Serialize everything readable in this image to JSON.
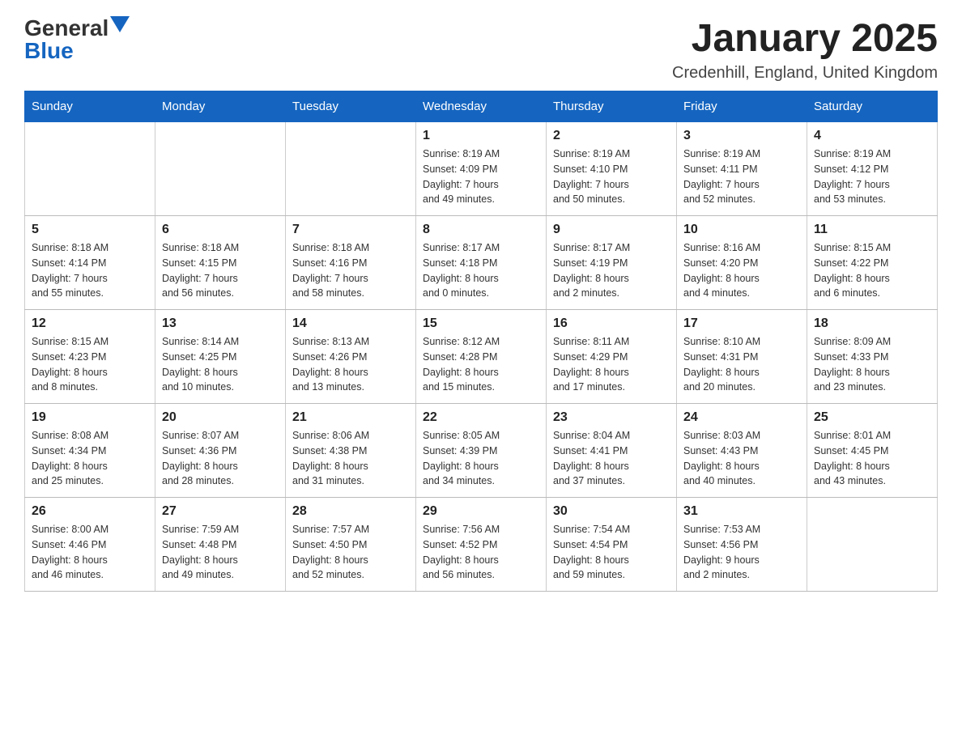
{
  "header": {
    "logo_general": "General",
    "logo_blue": "Blue",
    "month_title": "January 2025",
    "location": "Credenhill, England, United Kingdom"
  },
  "weekdays": [
    "Sunday",
    "Monday",
    "Tuesday",
    "Wednesday",
    "Thursday",
    "Friday",
    "Saturday"
  ],
  "weeks": [
    [
      {
        "day": "",
        "info": ""
      },
      {
        "day": "",
        "info": ""
      },
      {
        "day": "",
        "info": ""
      },
      {
        "day": "1",
        "info": "Sunrise: 8:19 AM\nSunset: 4:09 PM\nDaylight: 7 hours\nand 49 minutes."
      },
      {
        "day": "2",
        "info": "Sunrise: 8:19 AM\nSunset: 4:10 PM\nDaylight: 7 hours\nand 50 minutes."
      },
      {
        "day": "3",
        "info": "Sunrise: 8:19 AM\nSunset: 4:11 PM\nDaylight: 7 hours\nand 52 minutes."
      },
      {
        "day": "4",
        "info": "Sunrise: 8:19 AM\nSunset: 4:12 PM\nDaylight: 7 hours\nand 53 minutes."
      }
    ],
    [
      {
        "day": "5",
        "info": "Sunrise: 8:18 AM\nSunset: 4:14 PM\nDaylight: 7 hours\nand 55 minutes."
      },
      {
        "day": "6",
        "info": "Sunrise: 8:18 AM\nSunset: 4:15 PM\nDaylight: 7 hours\nand 56 minutes."
      },
      {
        "day": "7",
        "info": "Sunrise: 8:18 AM\nSunset: 4:16 PM\nDaylight: 7 hours\nand 58 minutes."
      },
      {
        "day": "8",
        "info": "Sunrise: 8:17 AM\nSunset: 4:18 PM\nDaylight: 8 hours\nand 0 minutes."
      },
      {
        "day": "9",
        "info": "Sunrise: 8:17 AM\nSunset: 4:19 PM\nDaylight: 8 hours\nand 2 minutes."
      },
      {
        "day": "10",
        "info": "Sunrise: 8:16 AM\nSunset: 4:20 PM\nDaylight: 8 hours\nand 4 minutes."
      },
      {
        "day": "11",
        "info": "Sunrise: 8:15 AM\nSunset: 4:22 PM\nDaylight: 8 hours\nand 6 minutes."
      }
    ],
    [
      {
        "day": "12",
        "info": "Sunrise: 8:15 AM\nSunset: 4:23 PM\nDaylight: 8 hours\nand 8 minutes."
      },
      {
        "day": "13",
        "info": "Sunrise: 8:14 AM\nSunset: 4:25 PM\nDaylight: 8 hours\nand 10 minutes."
      },
      {
        "day": "14",
        "info": "Sunrise: 8:13 AM\nSunset: 4:26 PM\nDaylight: 8 hours\nand 13 minutes."
      },
      {
        "day": "15",
        "info": "Sunrise: 8:12 AM\nSunset: 4:28 PM\nDaylight: 8 hours\nand 15 minutes."
      },
      {
        "day": "16",
        "info": "Sunrise: 8:11 AM\nSunset: 4:29 PM\nDaylight: 8 hours\nand 17 minutes."
      },
      {
        "day": "17",
        "info": "Sunrise: 8:10 AM\nSunset: 4:31 PM\nDaylight: 8 hours\nand 20 minutes."
      },
      {
        "day": "18",
        "info": "Sunrise: 8:09 AM\nSunset: 4:33 PM\nDaylight: 8 hours\nand 23 minutes."
      }
    ],
    [
      {
        "day": "19",
        "info": "Sunrise: 8:08 AM\nSunset: 4:34 PM\nDaylight: 8 hours\nand 25 minutes."
      },
      {
        "day": "20",
        "info": "Sunrise: 8:07 AM\nSunset: 4:36 PM\nDaylight: 8 hours\nand 28 minutes."
      },
      {
        "day": "21",
        "info": "Sunrise: 8:06 AM\nSunset: 4:38 PM\nDaylight: 8 hours\nand 31 minutes."
      },
      {
        "day": "22",
        "info": "Sunrise: 8:05 AM\nSunset: 4:39 PM\nDaylight: 8 hours\nand 34 minutes."
      },
      {
        "day": "23",
        "info": "Sunrise: 8:04 AM\nSunset: 4:41 PM\nDaylight: 8 hours\nand 37 minutes."
      },
      {
        "day": "24",
        "info": "Sunrise: 8:03 AM\nSunset: 4:43 PM\nDaylight: 8 hours\nand 40 minutes."
      },
      {
        "day": "25",
        "info": "Sunrise: 8:01 AM\nSunset: 4:45 PM\nDaylight: 8 hours\nand 43 minutes."
      }
    ],
    [
      {
        "day": "26",
        "info": "Sunrise: 8:00 AM\nSunset: 4:46 PM\nDaylight: 8 hours\nand 46 minutes."
      },
      {
        "day": "27",
        "info": "Sunrise: 7:59 AM\nSunset: 4:48 PM\nDaylight: 8 hours\nand 49 minutes."
      },
      {
        "day": "28",
        "info": "Sunrise: 7:57 AM\nSunset: 4:50 PM\nDaylight: 8 hours\nand 52 minutes."
      },
      {
        "day": "29",
        "info": "Sunrise: 7:56 AM\nSunset: 4:52 PM\nDaylight: 8 hours\nand 56 minutes."
      },
      {
        "day": "30",
        "info": "Sunrise: 7:54 AM\nSunset: 4:54 PM\nDaylight: 8 hours\nand 59 minutes."
      },
      {
        "day": "31",
        "info": "Sunrise: 7:53 AM\nSunset: 4:56 PM\nDaylight: 9 hours\nand 2 minutes."
      },
      {
        "day": "",
        "info": ""
      }
    ]
  ]
}
